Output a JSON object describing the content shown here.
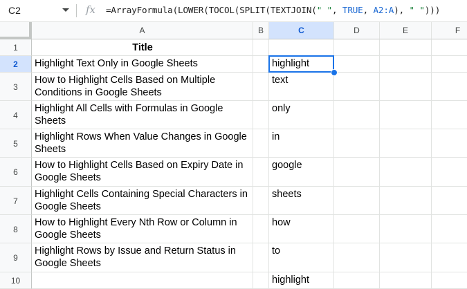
{
  "namebox": {
    "value": "C2"
  },
  "formula_bar": {
    "fx_label": "fx",
    "parts": [
      {
        "text": "=ArrayFormula(LOWER(TOCOL(SPLIT(TEXTJOIN(",
        "kind": "plain"
      },
      {
        "text": "\" \"",
        "kind": "str"
      },
      {
        "text": ", ",
        "kind": "plain"
      },
      {
        "text": "TRUE",
        "kind": "kw"
      },
      {
        "text": ", ",
        "kind": "plain"
      },
      {
        "text": "A2:A",
        "kind": "rng"
      },
      {
        "text": "), ",
        "kind": "plain"
      },
      {
        "text": "\" \"",
        "kind": "str"
      },
      {
        "text": ")))",
        "kind": "plain"
      }
    ]
  },
  "columns": [
    "A",
    "B",
    "C",
    "D",
    "E",
    "F"
  ],
  "selected_column": "C",
  "selected_row": "2",
  "rows": [
    {
      "num": "1",
      "a": "Title",
      "c": ""
    },
    {
      "num": "2",
      "a": "Highlight Text Only in Google Sheets",
      "c": "highlight"
    },
    {
      "num": "3",
      "a": "How to Highlight Cells Based on Multiple Conditions in Google Sheets",
      "c": "text"
    },
    {
      "num": "4",
      "a": "Highlight All Cells with Formulas in Google Sheets",
      "c": "only"
    },
    {
      "num": "5",
      "a": "Highlight Rows When Value Changes in Google Sheets",
      "c": "in"
    },
    {
      "num": "6",
      "a": "How to Highlight Cells Based on Expiry Date in Google Sheets",
      "c": "google"
    },
    {
      "num": "7",
      "a": "Highlight Cells Containing Special Characters in Google Sheets",
      "c": "sheets"
    },
    {
      "num": "8",
      "a": "How to Highlight Every Nth Row or Column in Google Sheets",
      "c": "how"
    },
    {
      "num": "9",
      "a": "Highlight Rows by Issue and Return Status in Google Sheets",
      "c": "to"
    },
    {
      "num": "10",
      "a": "",
      "c": "highlight"
    }
  ]
}
